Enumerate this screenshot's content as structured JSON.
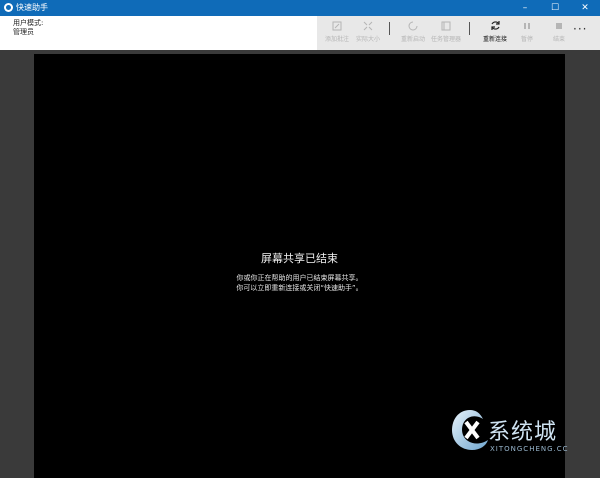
{
  "titlebar": {
    "title": "快速助手",
    "controls": {
      "minimize": "–",
      "maximize": "☐",
      "close": "✕"
    }
  },
  "user": {
    "mode_label": "用户模式:",
    "role": "管理员"
  },
  "toolbar": {
    "items": [
      {
        "label": "添加批注",
        "icon": "annotate-icon",
        "enabled": false
      },
      {
        "label": "实际大小",
        "icon": "actual-size-icon",
        "enabled": false
      },
      {
        "label": "重新启动",
        "icon": "restart-icon",
        "enabled": false
      },
      {
        "label": "任务管理器",
        "icon": "task-manager-icon",
        "enabled": false
      },
      {
        "label": "重新连接",
        "icon": "reconnect-icon",
        "enabled": true
      },
      {
        "label": "暂停",
        "icon": "pause-icon",
        "enabled": false
      },
      {
        "label": "结束",
        "icon": "stop-icon",
        "enabled": false
      }
    ],
    "more": "···"
  },
  "message": {
    "title": "屏幕共享已结束",
    "line1": "你或你正在帮助的用户已结束屏幕共享。",
    "line2": "你可以立即重新连接或关闭“快速助手”。"
  },
  "watermark": {
    "text": "系统城",
    "subtext": "XITONGCHENG.CC"
  },
  "colors": {
    "titlebar": "#0f6bb8",
    "screen": "#000000",
    "background": "#3a3a3a"
  }
}
